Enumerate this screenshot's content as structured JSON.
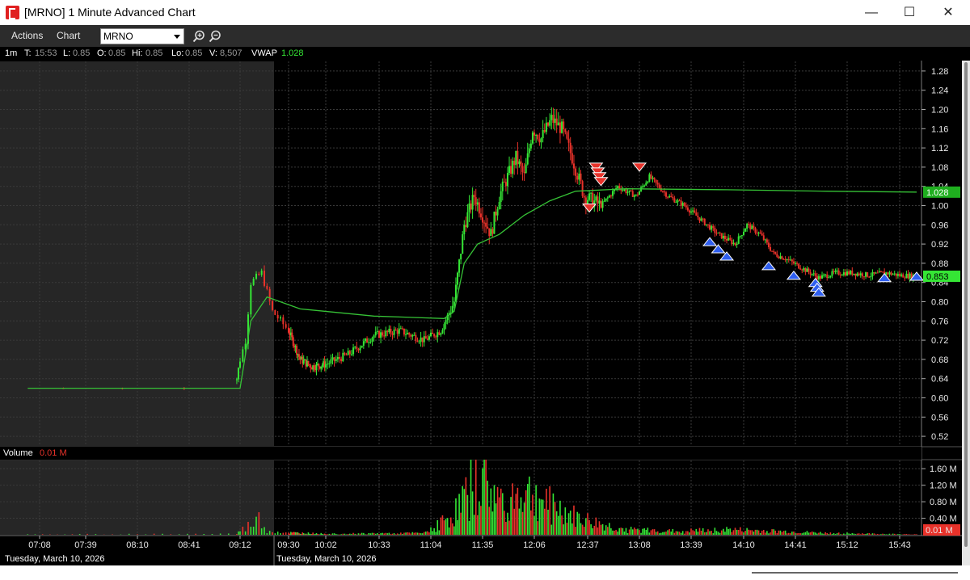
{
  "window": {
    "title": "[MRNO] 1 Minute Advanced Chart",
    "minimize_glyph": "—",
    "maximize_glyph": "☐",
    "close_glyph": "✕"
  },
  "toolbar": {
    "actions_label": "Actions",
    "chart_label": "Chart",
    "symbol_value": "MRNO",
    "zoom_in_icon": "zoom-in-icon",
    "zoom_out_icon": "zoom-out-icon"
  },
  "info": {
    "interval": "1m",
    "t_label": "T:",
    "t_value": "15:53",
    "l_label": "L:",
    "l_value": "0.85",
    "o_label": "O:",
    "o_value": "0.85",
    "hi_label": "Hi:",
    "hi_value": "0.85",
    "lo_label": "Lo:",
    "lo_value": "0.85",
    "v_label": "V:",
    "v_value": "8,507",
    "vwap_label": "VWAP",
    "vwap_value": "1.028"
  },
  "volume_header": {
    "label": "Volume",
    "value": "0.01 M"
  },
  "dates": {
    "left_date": "Tuesday, March 10, 2026",
    "right_date": "Tuesday, March 10, 2026"
  },
  "colors": {
    "up": "#35e635",
    "down": "#e8322a",
    "vwap": "#36c236",
    "premarket_bg": "#262626",
    "grid": "#3a3a3a",
    "sell_marker": "#e8322a",
    "buy_marker": "#2f5ff0"
  },
  "chart_data": [
    {
      "type": "candlestick",
      "price_axis_ticks": [
        1.28,
        1.24,
        1.2,
        1.16,
        1.12,
        1.08,
        1.04,
        1.0,
        0.96,
        0.92,
        0.88,
        0.84,
        0.8,
        0.76,
        0.72,
        0.68,
        0.64,
        0.6,
        0.56,
        0.52
      ],
      "ylim": [
        0.5,
        1.3
      ],
      "time_axis_ticks": [
        "07:08",
        "07:39",
        "08:10",
        "08:41",
        "09:12",
        "09:30",
        "10:02",
        "10:33",
        "11:04",
        "11:35",
        "12:06",
        "12:37",
        "13:08",
        "13:39",
        "14:10",
        "14:41",
        "15:12",
        "15:43"
      ],
      "market_open": "09:30",
      "last_price_badge": "0.853",
      "vwap_badge": "1.028",
      "price_path": [
        [
          "07:00",
          0.62
        ],
        [
          "08:00",
          0.62
        ],
        [
          "09:00",
          0.62
        ],
        [
          "09:10",
          0.64
        ],
        [
          "09:14",
          0.72
        ],
        [
          "09:16",
          0.84
        ],
        [
          "09:20",
          0.86
        ],
        [
          "09:24",
          0.78
        ],
        [
          "09:30",
          0.74
        ],
        [
          "09:40",
          0.68
        ],
        [
          "09:50",
          0.665
        ],
        [
          "10:02",
          0.67
        ],
        [
          "10:15",
          0.69
        ],
        [
          "10:30",
          0.73
        ],
        [
          "10:45",
          0.74
        ],
        [
          "11:00",
          0.72
        ],
        [
          "11:10",
          0.74
        ],
        [
          "11:18",
          0.8
        ],
        [
          "11:24",
          0.96
        ],
        [
          "11:30",
          1.02
        ],
        [
          "11:35",
          0.98
        ],
        [
          "11:40",
          0.94
        ],
        [
          "11:45",
          1.02
        ],
        [
          "11:55",
          1.1
        ],
        [
          "12:00",
          1.06
        ],
        [
          "12:05",
          1.16
        ],
        [
          "12:10",
          1.14
        ],
        [
          "12:16",
          1.18
        ],
        [
          "12:22",
          1.16
        ],
        [
          "12:28",
          1.1
        ],
        [
          "12:35",
          1.02
        ],
        [
          "12:45",
          1.0
        ],
        [
          "12:55",
          1.04
        ],
        [
          "13:00",
          1.03
        ],
        [
          "13:06",
          1.02
        ],
        [
          "13:14",
          1.06
        ],
        [
          "13:25",
          1.02
        ],
        [
          "13:35",
          1.0
        ],
        [
          "13:45",
          0.97
        ],
        [
          "13:55",
          0.94
        ],
        [
          "14:05",
          0.92
        ],
        [
          "14:12",
          0.96
        ],
        [
          "14:20",
          0.94
        ],
        [
          "14:28",
          0.9
        ],
        [
          "14:35",
          0.89
        ],
        [
          "14:45",
          0.87
        ],
        [
          "14:55",
          0.85
        ],
        [
          "15:05",
          0.86
        ],
        [
          "15:15",
          0.86
        ],
        [
          "15:25",
          0.855
        ],
        [
          "15:35",
          0.86
        ],
        [
          "15:43",
          0.855
        ],
        [
          "15:53",
          0.853
        ]
      ],
      "vwap_path": [
        [
          "07:00",
          0.62
        ],
        [
          "09:12",
          0.62
        ],
        [
          "09:16",
          0.76
        ],
        [
          "09:22",
          0.81
        ],
        [
          "09:40",
          0.785
        ],
        [
          "10:30",
          0.77
        ],
        [
          "11:12",
          0.765
        ],
        [
          "11:18",
          0.78
        ],
        [
          "11:24",
          0.88
        ],
        [
          "11:32",
          0.92
        ],
        [
          "11:45",
          0.94
        ],
        [
          "12:00",
          0.98
        ],
        [
          "12:15",
          1.01
        ],
        [
          "12:30",
          1.03
        ],
        [
          "13:00",
          1.035
        ],
        [
          "14:00",
          1.033
        ],
        [
          "15:00",
          1.03
        ],
        [
          "15:53",
          1.028
        ]
      ],
      "sell_markers": [
        [
          "12:42",
          1.08
        ],
        [
          "12:43",
          1.07
        ],
        [
          "12:44",
          1.06
        ],
        [
          "12:45",
          1.05
        ],
        [
          "12:38",
          0.995
        ],
        [
          "13:08",
          1.08
        ]
      ],
      "buy_markers": [
        [
          "13:50",
          0.925
        ],
        [
          "13:55",
          0.91
        ],
        [
          "14:00",
          0.895
        ],
        [
          "14:25",
          0.875
        ],
        [
          "14:40",
          0.855
        ],
        [
          "14:53",
          0.84
        ],
        [
          "14:54",
          0.83
        ],
        [
          "14:55",
          0.82
        ],
        [
          "15:34",
          0.85
        ],
        [
          "15:53",
          0.853
        ]
      ]
    },
    {
      "type": "bar",
      "series_name": "Volume",
      "volume_axis_ticks": [
        "1.60 M",
        "1.20 M",
        "0.80 M",
        "0.40 M"
      ],
      "ylim": [
        0,
        1.8
      ],
      "last_volume_badge": "0.01 M",
      "volume_path": [
        [
          "07:00",
          0.01
        ],
        [
          "09:10",
          0.03
        ],
        [
          "09:15",
          0.25
        ],
        [
          "09:18",
          0.55
        ],
        [
          "09:22",
          0.12
        ],
        [
          "09:30",
          0.06
        ],
        [
          "10:00",
          0.03
        ],
        [
          "11:00",
          0.05
        ],
        [
          "11:18",
          0.6
        ],
        [
          "11:28",
          1.4
        ],
        [
          "11:35",
          1.65
        ],
        [
          "11:45",
          1.0
        ],
        [
          "12:00",
          1.25
        ],
        [
          "12:15",
          0.9
        ],
        [
          "12:30",
          0.5
        ],
        [
          "12:45",
          0.3
        ],
        [
          "13:00",
          0.15
        ],
        [
          "13:30",
          0.1
        ],
        [
          "14:00",
          0.15
        ],
        [
          "14:30",
          0.1
        ],
        [
          "15:00",
          0.05
        ],
        [
          "15:53",
          0.01
        ]
      ]
    }
  ]
}
